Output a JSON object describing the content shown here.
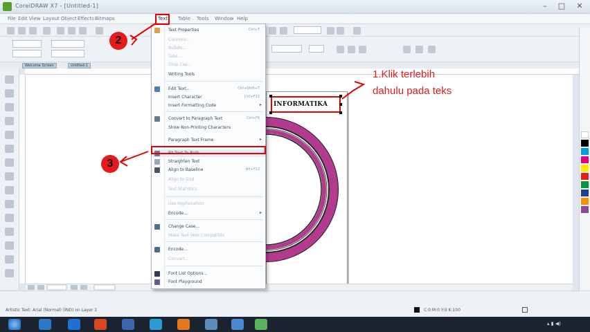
{
  "window": {
    "title": "CorelDRAW X7 - [Untitled-1]",
    "controls": [
      "–",
      "□",
      "✕"
    ]
  },
  "menubar": {
    "items": [
      {
        "label": "File"
      },
      {
        "label": "Edit"
      },
      {
        "label": "View"
      },
      {
        "label": "Layout"
      },
      {
        "label": "Object"
      },
      {
        "label": "Effects"
      },
      {
        "label": "Bitmaps"
      },
      {
        "label": "Text"
      },
      {
        "label": "Table"
      },
      {
        "label": "Tools"
      },
      {
        "label": "Window"
      },
      {
        "label": "Help"
      }
    ],
    "open_index": 7
  },
  "tabs": {
    "welcome": "Welcome Screen",
    "document": "Untitled-1"
  },
  "text_menu": {
    "items": [
      {
        "label": "Text Properties",
        "shortcut": "Ctrl+T",
        "dim": false,
        "icon": "text-properties-icon"
      },
      {
        "label": "Columns...",
        "dim": true,
        "icon": "none"
      },
      {
        "label": "Bullets...",
        "dim": true,
        "icon": "none"
      },
      {
        "label": "Tabs...",
        "dim": true,
        "icon": "none"
      },
      {
        "label": "Drop Cap...",
        "dim": true,
        "icon": "none"
      },
      {
        "label": "Writing Tools",
        "dim": false,
        "icon": "none"
      },
      {
        "label": "Edit Text...",
        "shortcut": "Ctrl+Shift+T",
        "dim": false,
        "icon": "edit-text-icon"
      },
      {
        "label": "Insert Character",
        "shortcut": "Ctrl+F11",
        "dim": false,
        "icon": "none"
      },
      {
        "label": "Insert Formatting Code",
        "dim": false,
        "arrow": true,
        "icon": "none"
      },
      {
        "label": "Convert to Paragraph Text",
        "shortcut": "Ctrl+F8",
        "dim": false,
        "icon": "convert-icon"
      },
      {
        "label": "Show Non-Printing Characters",
        "dim": false,
        "icon": "none"
      },
      {
        "label": "Paragraph Text Frame",
        "dim": false,
        "arrow": true,
        "icon": "none"
      },
      {
        "label": "Fit Text To Path",
        "dim": false,
        "highlight": true,
        "icon": "fit-path-icon"
      },
      {
        "label": "Straighten Text",
        "dim": false,
        "icon": "straighten-icon"
      },
      {
        "label": "Align to Baseline",
        "shortcut": "Alt+F12",
        "dim": false,
        "icon": "baseline-icon"
      },
      {
        "label": "Align to Grid",
        "dim": true,
        "icon": "none"
      },
      {
        "label": "Text Statistics",
        "dim": true,
        "icon": "none"
      },
      {
        "label": "Use Hyphenation",
        "dim": true,
        "icon": "none"
      },
      {
        "label": "Encode...",
        "dim": false,
        "arrow": true,
        "icon": "none"
      },
      {
        "label": "Change Case...",
        "dim": false,
        "icon": "case-icon"
      },
      {
        "label": "Make Text Web Compatible",
        "dim": true,
        "icon": "none"
      },
      {
        "label": "Encode...",
        "dim": false,
        "icon": "encode-icon"
      },
      {
        "label": "Convert...",
        "dim": true,
        "icon": "none"
      },
      {
        "label": "Font List Options...",
        "dim": false,
        "icon": "font-list-icon"
      },
      {
        "label": "Font Playground",
        "dim": false,
        "icon": "font-play-icon"
      }
    ]
  },
  "document": {
    "text_object": "INFORMATIKA"
  },
  "annotations": {
    "step1": "1.Klik terlebih dahulu pada teks",
    "step2": "2",
    "step3": "3",
    "color": "#e31b1b"
  },
  "statusbar": {
    "left": "Artistic Text: Arial (Normal) (IND) on Layer 1",
    "right": "C:0 M:0 Y:0 K:100"
  },
  "colors": {
    "ring": "#b23a8f",
    "highlight": "#e60000"
  }
}
